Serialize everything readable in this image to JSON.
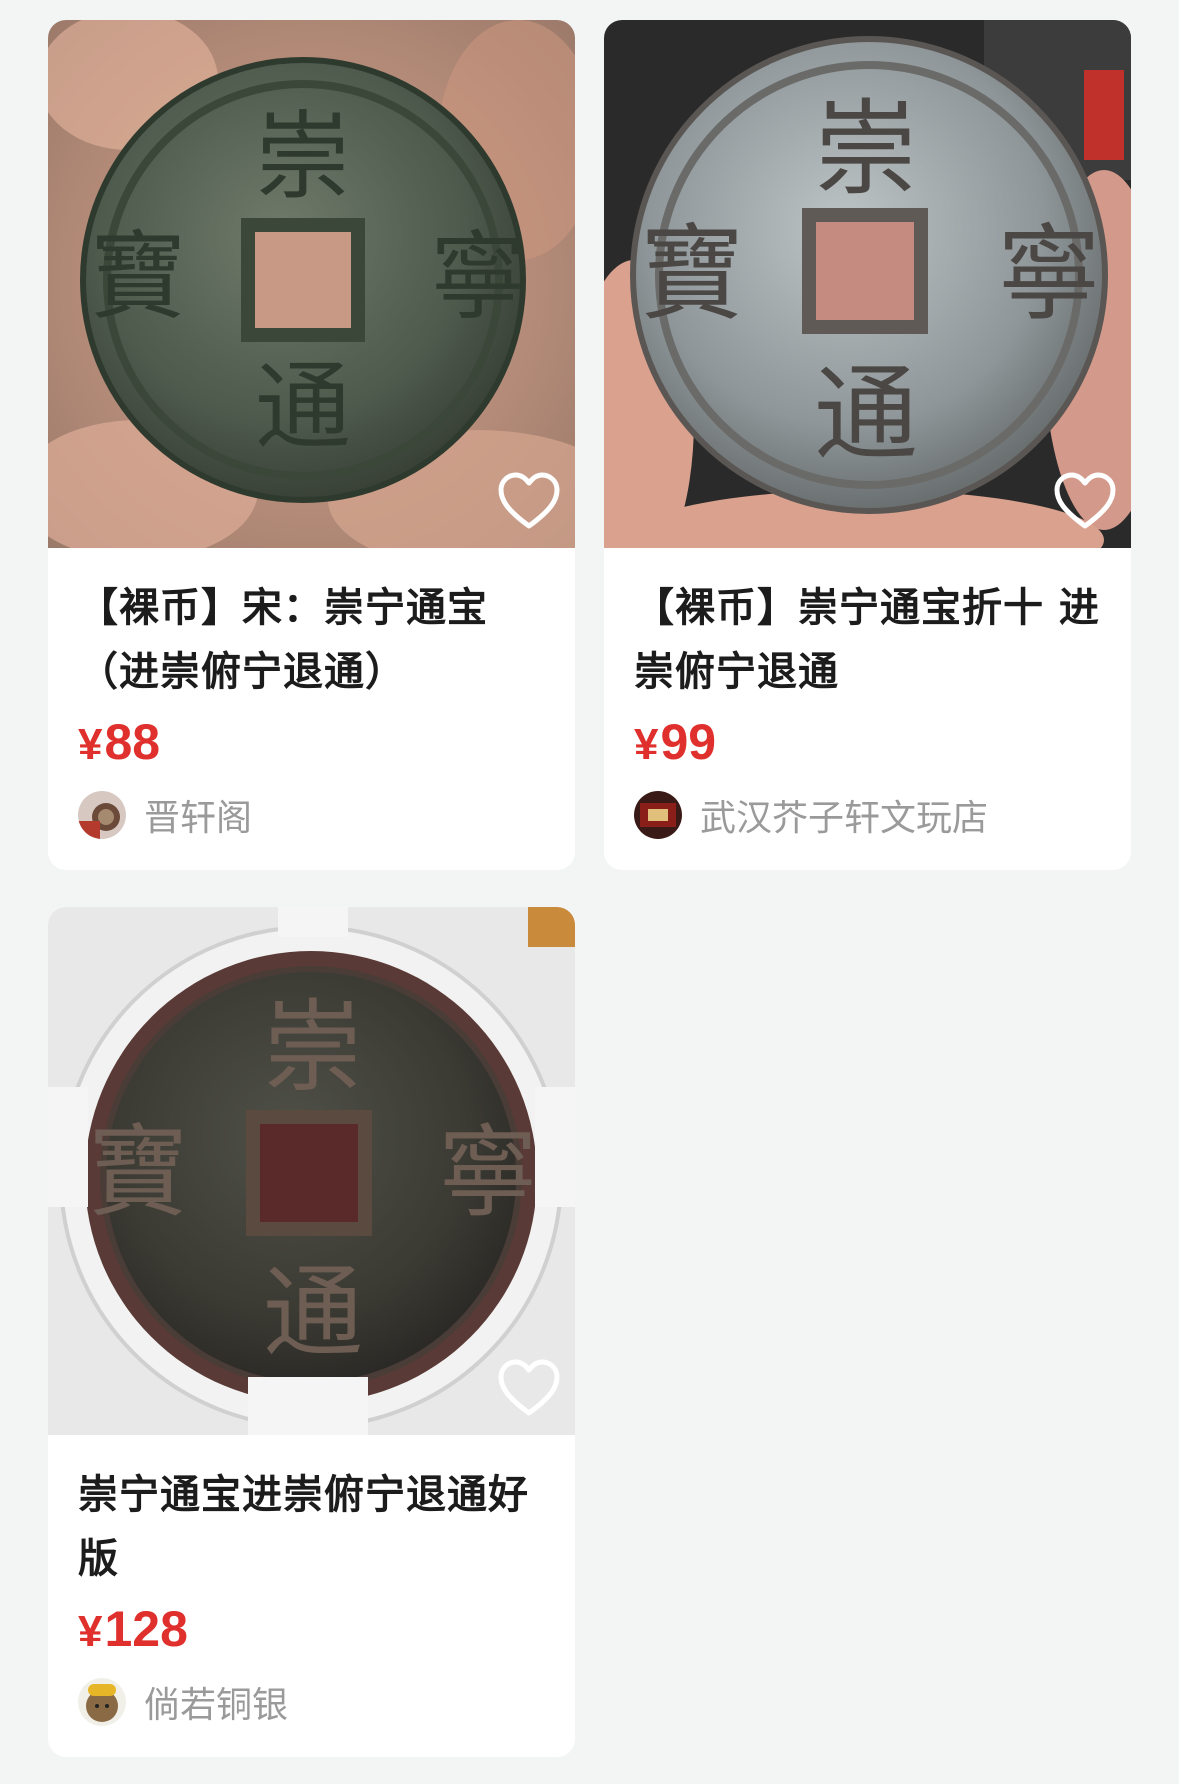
{
  "products": [
    {
      "title": "【裸币】宋：崇宁通宝（进崇俯宁退通）",
      "currency": "¥",
      "price": "88",
      "seller": "晋轩阁",
      "favorited": false,
      "image_icon": "coin-photo",
      "coin_inscription": [
        "崇",
        "寧",
        "通",
        "寶"
      ]
    },
    {
      "title": "【裸币】崇宁通宝折十 进崇俯宁退通",
      "currency": "¥",
      "price": "99",
      "seller": "武汉芥子轩文玩店",
      "favorited": false,
      "image_icon": "coin-photo",
      "coin_inscription": [
        "崇",
        "寧",
        "通",
        "寶"
      ]
    },
    {
      "title": "崇宁通宝进崇俯宁退通好版",
      "currency": "¥",
      "price": "128",
      "seller": "倘若铜银",
      "favorited": false,
      "image_icon": "slabbed-coin-photo",
      "coin_inscription": [
        "崇",
        "寧",
        "通",
        "寶"
      ]
    }
  ],
  "colors": {
    "price": "#e0302d",
    "background": "#f3f4f4",
    "card": "#ffffff",
    "seller_text": "#9a9a9a"
  }
}
